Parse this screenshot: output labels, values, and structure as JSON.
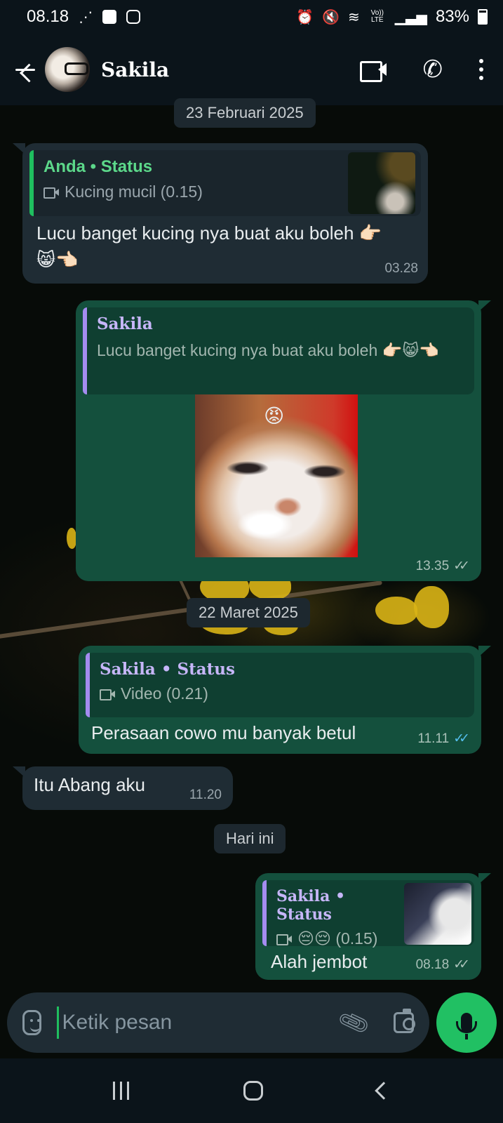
{
  "status_bar": {
    "time": "08.18",
    "network_label": "Vo)) LTE",
    "battery": "83%"
  },
  "header": {
    "contact_name": "Sakila"
  },
  "chat": {
    "date_1": "23 Februari 2025",
    "date_2": "22 Maret 2025",
    "date_3": "Hari ini",
    "messages": [
      {
        "direction": "incoming",
        "quote_title": "Anda • Status",
        "quote_sub": "Kucing mucil (0.15)",
        "text": "Lucu banget kucing nya buat aku boleh 👉🏻😸👈🏻",
        "time": "03.28"
      },
      {
        "direction": "outgoing",
        "quote_title": "Sakila",
        "quote_sub": "Lucu banget kucing nya buat aku boleh 👉🏻😸👈🏻",
        "sticker_emoji": "😡",
        "time": "13.35",
        "ticks": "✓✓"
      },
      {
        "direction": "outgoing",
        "quote_title": "Sakila • Status",
        "quote_sub": "Video (0.21)",
        "text": "Perasaan cowo mu banyak betul",
        "time": "11.11",
        "ticks": "✓✓"
      },
      {
        "direction": "incoming",
        "text": "Itu Abang aku",
        "time": "11.20"
      },
      {
        "direction": "outgoing",
        "quote_title": "Sakila • Status",
        "quote_sub": "😔😔 (0.15)",
        "text": "Alah jembot",
        "time": "08.18",
        "ticks": "✓✓"
      }
    ]
  },
  "composer": {
    "placeholder": "Ketik pesan"
  },
  "colors": {
    "outgoing_bubble": "#14503d",
    "incoming_bubble": "#1f2c34",
    "accent_green": "#21c063",
    "read_ticks": "#53bdeb"
  }
}
